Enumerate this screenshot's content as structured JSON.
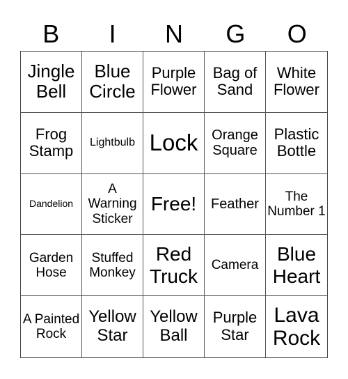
{
  "header": {
    "letters": [
      "B",
      "I",
      "N",
      "G",
      "O"
    ]
  },
  "cells": [
    [
      "Jingle Bell",
      "Blue Circle",
      "Purple Flower",
      "Bag of Sand",
      "White Flower"
    ],
    [
      "Frog Stamp",
      "Lightbulb",
      "Lock",
      "Orange Square",
      "Plastic Bottle"
    ],
    [
      "Dandelion",
      "A Warning Sticker",
      "Free!",
      "Feather",
      "The Number 1"
    ],
    [
      "Garden Hose",
      "Stuffed Monkey",
      "Red Truck",
      "Camera",
      "Blue Heart"
    ],
    [
      "A Painted Rock",
      "Yellow Star",
      "Yellow Ball",
      "Purple Star",
      "Lava Rock"
    ]
  ]
}
